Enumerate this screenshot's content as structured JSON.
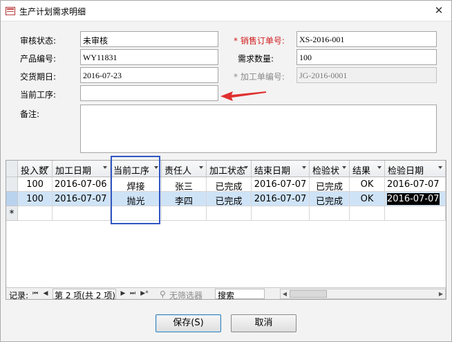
{
  "window": {
    "title": "生产计划需求明细",
    "close_glyph": "✕"
  },
  "form": {
    "audit_status": {
      "label": "审核状态:",
      "value": "未审核"
    },
    "sales_order_no": {
      "label": "* 销售订单号:",
      "value": "XS-2016-001"
    },
    "product_no": {
      "label": "产品编号:",
      "value": "WY11831"
    },
    "required_qty": {
      "label": "需求数量:",
      "value": "100"
    },
    "delivery_date": {
      "label": "交货期日:",
      "value": "2016-07-23"
    },
    "work_order_no": {
      "label": "* 加工单编号:",
      "value": "JG-2016-0001"
    },
    "current_process": {
      "label": "当前工序:",
      "value": ""
    },
    "remarks": {
      "label": "备注:",
      "value": ""
    }
  },
  "grid": {
    "columns": [
      "投入数",
      "加工日期",
      "当前工序",
      "责任人",
      "加工状态",
      "结束日期",
      "检验状",
      "结果",
      "检验日期"
    ],
    "rows": [
      [
        "100",
        "2016-07-06",
        "焊接",
        "张三",
        "已完成",
        "2016-07-07",
        "已完成",
        "OK",
        "2016-07-07"
      ],
      [
        "100",
        "2016-07-07",
        "抛光",
        "李四",
        "已完成",
        "2016-07-07",
        "已完成",
        "OK",
        "2016-07-07"
      ]
    ],
    "new_row_marker": "*"
  },
  "navigator": {
    "label": "记录:",
    "position": "第 2 项(共 2 项)",
    "first": "⏮",
    "prev": "◀",
    "next": "▶",
    "last": "⏭",
    "new": "▶*",
    "filter": "无筛选器",
    "search": "搜索"
  },
  "buttons": {
    "save": "保存(S)",
    "cancel": "取消"
  },
  "colors": {
    "required_label": "#d21d1d",
    "highlight_box": "#2f56c4",
    "annotation_arrow": "#e03030",
    "selected_row": "#cfe3f7"
  },
  "icons": [
    "form-icon",
    "close-icon",
    "filter-icon",
    "arrow-annotation-icon"
  ]
}
